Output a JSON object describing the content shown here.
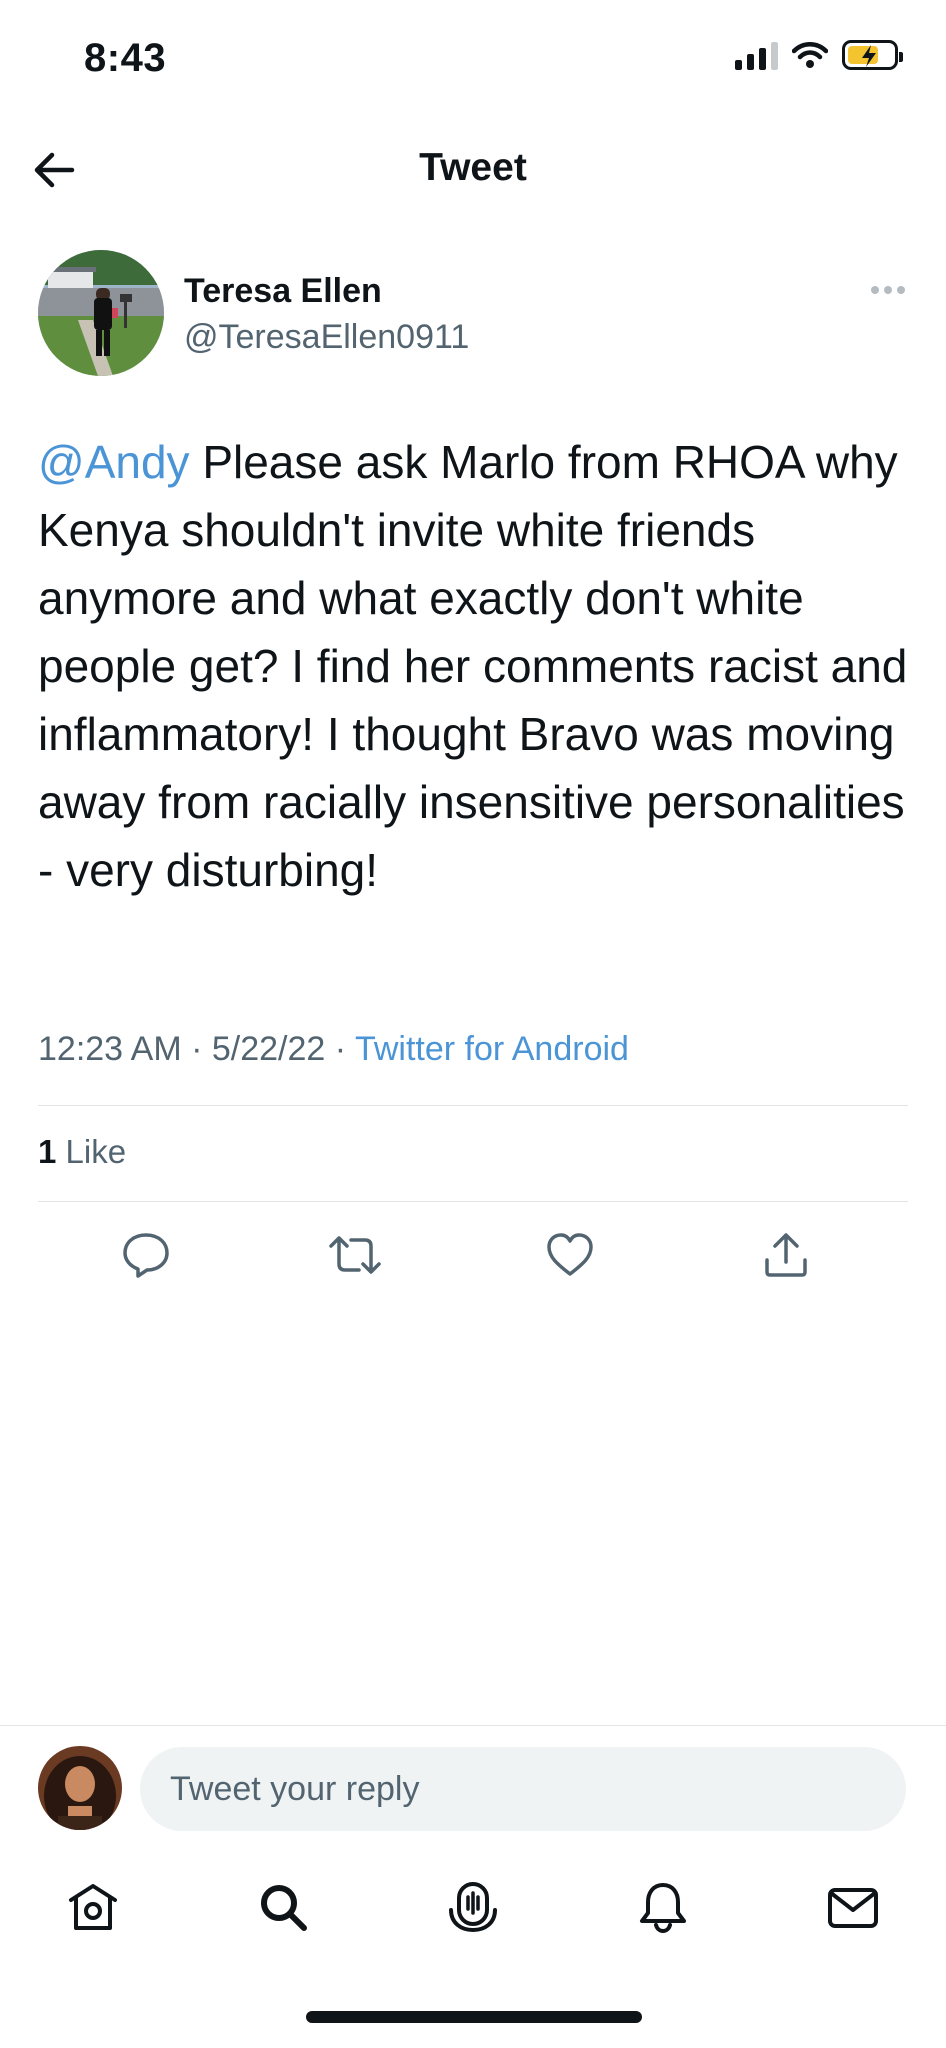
{
  "status_bar": {
    "time": "8:43"
  },
  "header": {
    "title": "Tweet"
  },
  "tweet": {
    "author_name": "Teresa Ellen",
    "author_handle": "@TeresaEllen0911",
    "mention": "@Andy",
    "body": " Please ask Marlo from RHOA why Kenya shouldn't invite white friends anymore and what exactly don't white people get? I find her comments racist and inflammatory! I thought Bravo was moving away from racially insensitive personalities - very disturbing!",
    "time": "12:23 AM",
    "date": "5/22/22",
    "separator": " · ",
    "source": "Twitter for Android",
    "like_count": "1",
    "like_label": " Like"
  },
  "reply": {
    "placeholder": "Tweet your reply"
  },
  "icons": {
    "back": "arrow-left-icon",
    "more": "more-horizontal-icon",
    "reply": "reply-icon",
    "retweet": "retweet-icon",
    "like": "heart-icon",
    "share": "share-icon",
    "tabs": [
      "home-icon",
      "search-icon",
      "spaces-icon",
      "notifications-icon",
      "messages-icon"
    ]
  },
  "colors": {
    "link": "#4b94d6",
    "secondary_text": "#536471",
    "battery": "#f4c430"
  }
}
